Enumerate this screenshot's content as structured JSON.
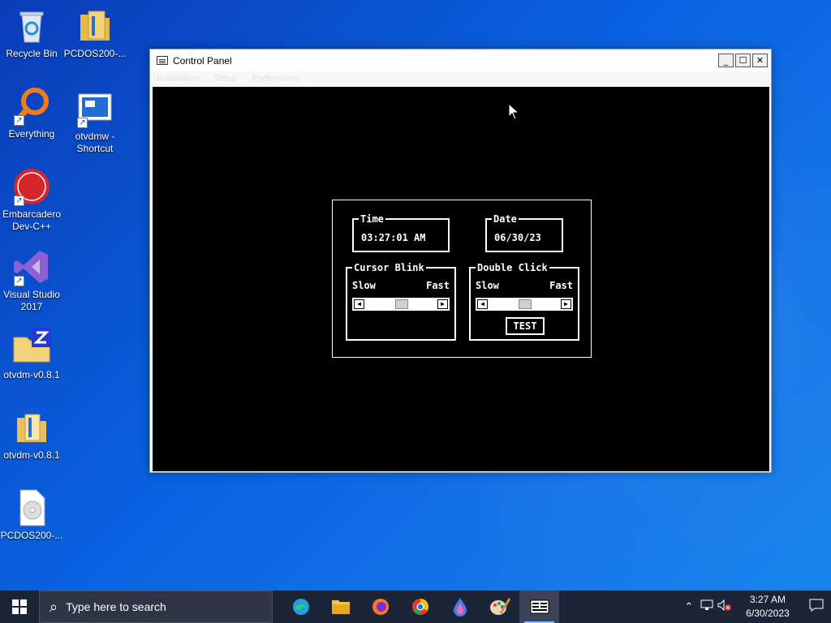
{
  "desktop": {
    "icons": [
      {
        "label": "Recycle Bin",
        "icon": "recycle-bin-icon"
      },
      {
        "label": "PCDOS200-...",
        "icon": "folder-icon"
      },
      {
        "label": "Everything",
        "icon": "everything-search-icon"
      },
      {
        "label": "otvdmw - Shortcut",
        "icon": "otvdmw-app-icon"
      },
      {
        "label": "Embarcadero Dev-C++",
        "icon": "devcpp-icon"
      },
      {
        "label": "Visual Studio 2017",
        "icon": "visual-studio-icon"
      },
      {
        "label": "otvdm-v0.8.1",
        "icon": "zip-folder-icon"
      },
      {
        "label": "otvdm-v0.8.1",
        "icon": "folder-icon"
      },
      {
        "label": "PCDOS200-...",
        "icon": "disc-image-icon"
      }
    ]
  },
  "window": {
    "title": "Control Panel",
    "menu": [
      "Installation",
      "Setup",
      "Preferences"
    ],
    "buttons": {
      "minimize": "_",
      "maximize": "☐",
      "close": "✕"
    }
  },
  "control_panel": {
    "time": {
      "legend": "Time",
      "value": "03:27:01 AM"
    },
    "date": {
      "legend": "Date",
      "value": "06/30/23"
    },
    "cursor_blink": {
      "legend": "Cursor Blink",
      "slow": "Slow",
      "fast": "Fast",
      "level": 0.5
    },
    "double_click": {
      "legend": "Double Click",
      "slow": "Slow",
      "fast": "Fast",
      "level": 0.5,
      "test_label": "TEST"
    }
  },
  "taskbar": {
    "search_placeholder": "Type here to search",
    "apps": [
      "edge-icon",
      "file-explorer-icon",
      "firefox-icon",
      "chrome-icon",
      "paint-3d-icon",
      "paint-icon",
      "control-panel-app-icon"
    ],
    "clock": {
      "time": "3:27 AM",
      "date": "6/30/2023"
    }
  }
}
